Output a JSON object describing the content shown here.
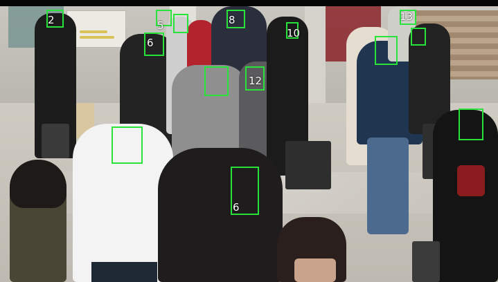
{
  "detections": [
    {
      "label": "2"
    },
    {
      "label": "5"
    },
    {
      "label": "6"
    },
    {
      "label": "10"
    },
    {
      "label": "13"
    },
    {
      "label": "8"
    },
    {
      "label": "12"
    },
    {
      "label": "6"
    }
  ],
  "colors": {
    "box": "#27e33a",
    "label": "#ffffff"
  }
}
